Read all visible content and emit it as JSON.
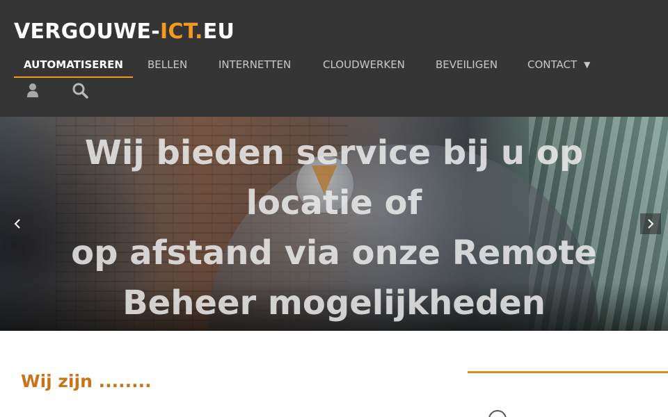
{
  "header": {
    "logo": {
      "part1": "VERGOUWE-",
      "part2": "ICT",
      "part3": ".",
      "part4": "EU"
    },
    "nav": [
      {
        "label": "AUTOMATISEREN",
        "active": true
      },
      {
        "label": "BELLEN"
      },
      {
        "label": "INTERNETTEN"
      },
      {
        "label": "CLOUDWERKEN"
      },
      {
        "label": "BEVEILIGEN"
      },
      {
        "label": "CONTACT",
        "dropdown": true
      }
    ],
    "caret": "▼",
    "tools": {
      "user_icon": "user-icon",
      "search_icon": "search-icon"
    }
  },
  "hero": {
    "lines": [
      "Wij bieden service bij u op",
      "locatie of",
      "op afstand via onze Remote",
      "Beheer mogelijkheden"
    ],
    "prev_icon": "chevron-left-icon",
    "next_icon": "chevron-right-icon"
  },
  "main": {
    "title": "Wij zijn ........"
  },
  "colors": {
    "header_bg": "#353535",
    "accent": "#f39a1e",
    "title_orange": "#c9731a",
    "nav_text": "#c8c8c8"
  }
}
